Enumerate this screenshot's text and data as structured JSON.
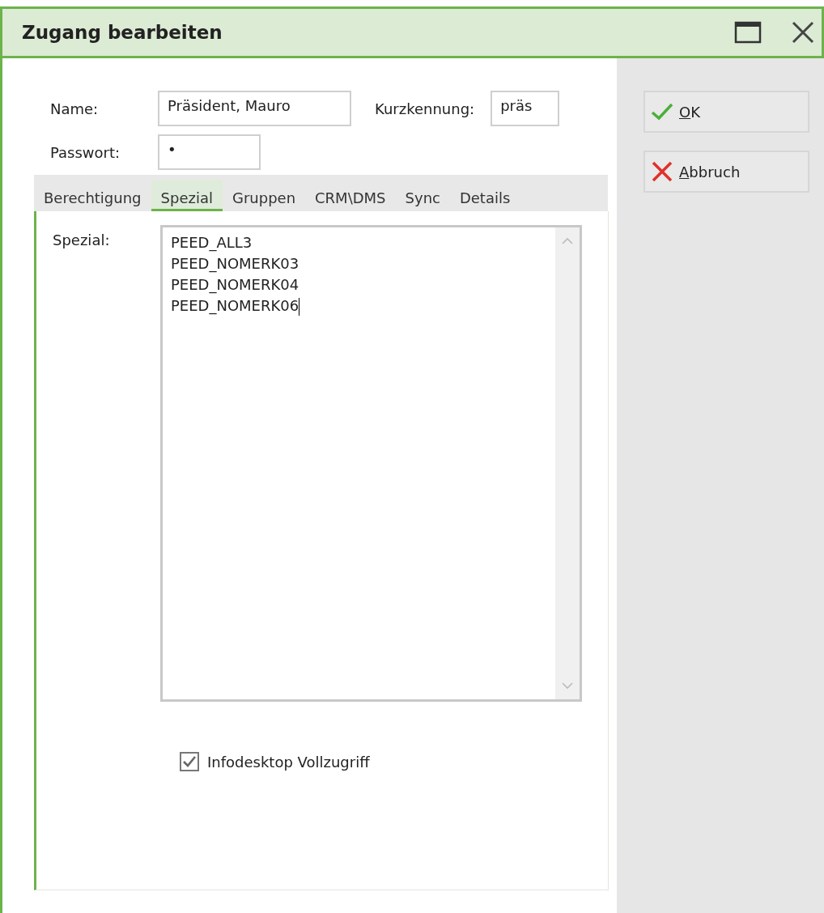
{
  "window": {
    "title": "Zugang bearbeiten"
  },
  "fields": [
    {
      "label": "Name:",
      "value": "Präsident, Mauro",
      "kind": "wide"
    },
    {
      "label": "Kurzkennung:",
      "value": "präs",
      "kind": "short"
    },
    {
      "label": "Passwort:",
      "value": "•",
      "kind": "medium"
    }
  ],
  "tabs": [
    {
      "label": "Berechtigung",
      "selected": false
    },
    {
      "label": "Spezial",
      "selected": true
    },
    {
      "label": "Gruppen",
      "selected": false
    },
    {
      "label": "CRM\\DMS",
      "selected": false
    },
    {
      "label": "Sync",
      "selected": false
    },
    {
      "label": "Details",
      "selected": false
    }
  ],
  "spezial": {
    "label": "Spezial:",
    "lines": [
      "PEED_ALL3",
      "PEED_NOMERK03",
      "PEED_NOMERK04",
      "PEED_NOMERK06"
    ]
  },
  "checkbox": {
    "label": "Infodesktop Vollzugriff",
    "checked": true
  },
  "buttons": [
    {
      "label": "OK",
      "kind": "ok",
      "underline_first": true
    },
    {
      "label": "Abbruch",
      "kind": "cancel",
      "underline_first": true
    }
  ]
}
